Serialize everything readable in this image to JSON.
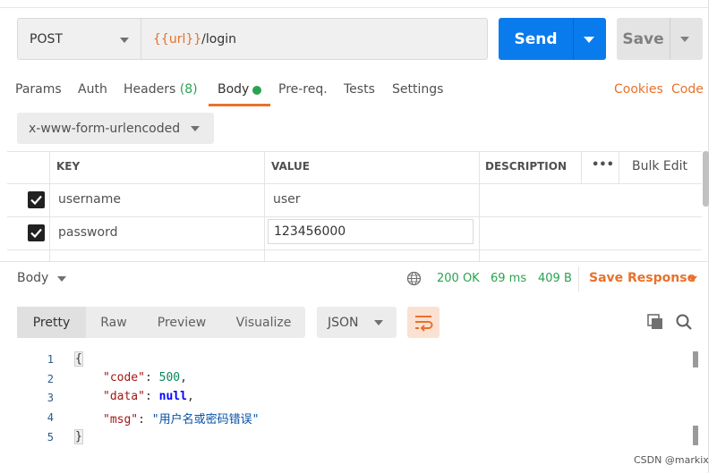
{
  "request": {
    "method": "POST",
    "url_variable": "{{url}}",
    "url_path": "/login",
    "send_label": "Send",
    "save_label": "Save"
  },
  "tabs": [
    {
      "label": "Params"
    },
    {
      "label": "Auth"
    },
    {
      "label": "Headers",
      "count": "(8)"
    },
    {
      "label": "Body",
      "active": true
    },
    {
      "label": "Pre-req."
    },
    {
      "label": "Tests"
    },
    {
      "label": "Settings"
    }
  ],
  "links": {
    "cookies": "Cookies",
    "code": "Code"
  },
  "body_type": "x-www-form-urlencoded",
  "table": {
    "headers": {
      "key": "KEY",
      "value": "VALUE",
      "description": "DESCRIPTION",
      "more": "•••",
      "bulk_edit": "Bulk Edit"
    },
    "rows": [
      {
        "checked": true,
        "key": "username",
        "value": "user",
        "description": ""
      },
      {
        "checked": true,
        "key": "password",
        "value": "123456000",
        "description": ""
      }
    ]
  },
  "response": {
    "title": "Body",
    "status": "200 OK",
    "time": "69 ms",
    "size": "409 B",
    "save_response": "Save Response",
    "view_tabs": [
      "Pretty",
      "Raw",
      "Preview",
      "Visualize"
    ],
    "active_view": "Pretty",
    "format": "JSON",
    "lines": [
      {
        "n": "1",
        "text": "{"
      },
      {
        "n": "2",
        "key": "\"code\"",
        "sep": ": ",
        "value": "500",
        "tail": ","
      },
      {
        "n": "3",
        "key": "\"data\"",
        "sep": ": ",
        "value": "null",
        "tail": ","
      },
      {
        "n": "4",
        "key": "\"msg\"",
        "sep": ": ",
        "value": "\"用户名或密码错误\"",
        "tail": ""
      },
      {
        "n": "5",
        "text": "}"
      }
    ]
  },
  "watermark": "CSDN @markix",
  "colors": {
    "accent": "#e8712c",
    "send": "#097bed",
    "success": "#29a351"
  }
}
